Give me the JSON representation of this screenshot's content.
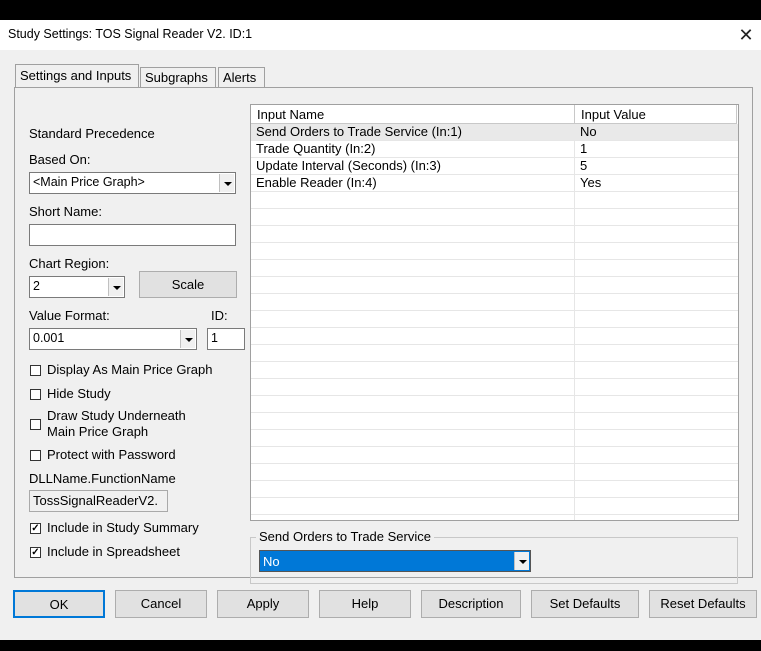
{
  "title": "Study Settings: TOS Signal Reader V2. ID:1",
  "tabs": [
    "Settings and Inputs",
    "Subgraphs",
    "Alerts"
  ],
  "left": {
    "standard_precedence": "Standard Precedence",
    "based_on_label": "Based On:",
    "based_on_value": "<Main Price Graph>",
    "short_name_label": "Short Name:",
    "short_name_value": "",
    "chart_region_label": "Chart Region:",
    "chart_region_value": "2",
    "scale_button": "Scale",
    "value_format_label": "Value Format:",
    "value_format_value": "0.001",
    "id_label": "ID:",
    "id_value": "1",
    "display_as_main": "Display As Main Price Graph",
    "hide_study": "Hide Study",
    "draw_underneath_1": "Draw Study Underneath",
    "draw_underneath_2": "Main Price Graph",
    "protect_password": "Protect with Password",
    "dll_label": "DLLName.FunctionName",
    "dll_value": "TossSignalReaderV2.",
    "include_summary": "Include in Study Summary",
    "include_spreadsheet": "Include in Spreadsheet",
    "checks": {
      "display_as_main": false,
      "hide_study": false,
      "draw_underneath": false,
      "protect_password": false,
      "include_summary": true,
      "include_spreadsheet": true
    }
  },
  "grid": {
    "col_name": "Input Name",
    "col_value": "Input Value",
    "rows": [
      {
        "name": "Send Orders to Trade Service   (In:1)",
        "value": "No"
      },
      {
        "name": "Trade Quantity   (In:2)",
        "value": "1"
      },
      {
        "name": "Update Interval (Seconds)   (In:3)",
        "value": "5"
      },
      {
        "name": "Enable Reader   (In:4)",
        "value": "Yes"
      }
    ]
  },
  "editor": {
    "group_label": "Send Orders to Trade Service",
    "value": "No"
  },
  "buttons": {
    "ok": "OK",
    "cancel": "Cancel",
    "apply": "Apply",
    "help": "Help",
    "description": "Description",
    "set_defaults": "Set Defaults",
    "reset_defaults": "Reset Defaults"
  },
  "icons": {
    "close": "close-icon",
    "dropdown": "chevron-down-icon",
    "check": "checkmark-icon"
  },
  "colors": {
    "selection": "#0078d7",
    "dialog_bg": "#f0f0f0"
  }
}
